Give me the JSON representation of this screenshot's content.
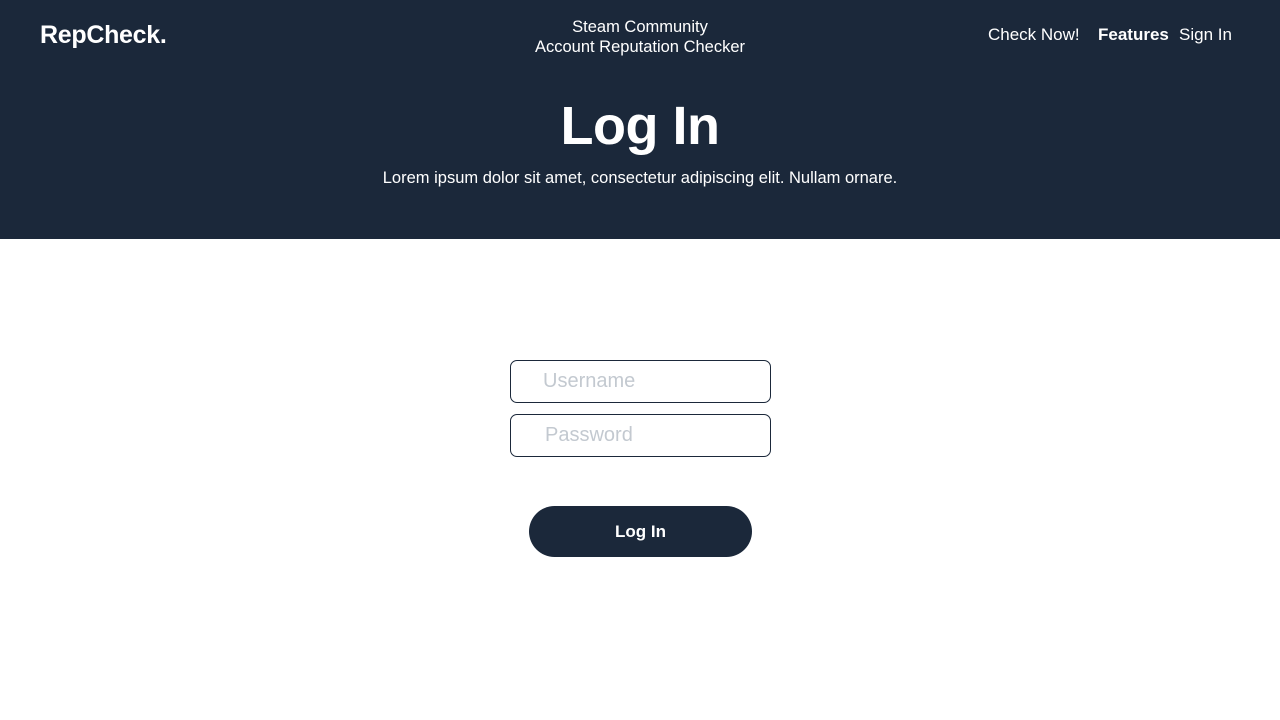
{
  "header": {
    "logo": "RepCheck.",
    "tagline_line1": "Steam Community",
    "tagline_line2": "Account Reputation Checker",
    "nav": {
      "check_now": "Check Now!",
      "features": "Features",
      "sign_in": "Sign In"
    }
  },
  "hero": {
    "title": "Log In",
    "subtitle": "Lorem ipsum dolor sit amet, consectetur adipiscing elit. Nullam ornare."
  },
  "form": {
    "username_placeholder": "Username",
    "username_value": "",
    "password_placeholder": "Password",
    "password_value": "",
    "submit_label": "Log In"
  },
  "colors": {
    "primary_navy": "#1b283a",
    "background": "#ffffff",
    "placeholder": "#c3c9d0"
  }
}
